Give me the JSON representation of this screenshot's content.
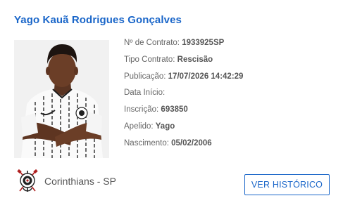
{
  "player": {
    "name": "Yago Kauã Rodrigues Gonçalves"
  },
  "details": [
    {
      "label": "Nº de Contrato: ",
      "value": "1933925SP"
    },
    {
      "label": "Tipo Contrato: ",
      "value": "Rescisão"
    },
    {
      "label": "Publicação: ",
      "value": "17/07/2026 14:42:29"
    },
    {
      "label": "Data Início:",
      "value": ""
    },
    {
      "label": "Inscrição: ",
      "value": "693850"
    },
    {
      "label": "Apelido: ",
      "value": "Yago"
    },
    {
      "label": "Nascimento: ",
      "value": "05/02/2006"
    }
  ],
  "club": {
    "name": "Corinthians - SP",
    "logo_icon": "corinthians-crest-icon"
  },
  "actions": {
    "history_label": "VER HISTÓRICO"
  },
  "colors": {
    "accent": "#1a66c9",
    "text": "#555555",
    "photo_background": "#f1f1f1"
  }
}
